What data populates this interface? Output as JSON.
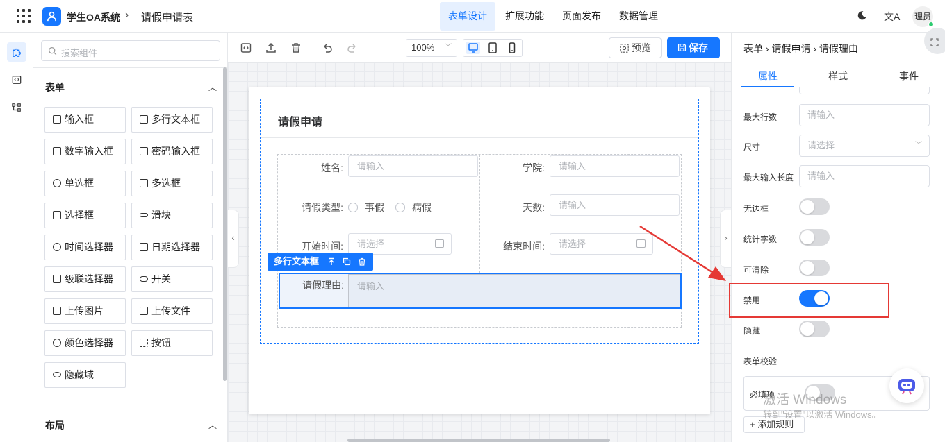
{
  "header": {
    "app_name": "学生OA系统",
    "crumb_sep": "›",
    "page_name": "请假申请表",
    "nav": [
      "表单设计",
      "扩展功能",
      "页面发布",
      "数据管理"
    ],
    "active_nav": "表单设计",
    "translate_glyph": "文A",
    "user": "理员"
  },
  "left_panel": {
    "search_placeholder": "搜索组件",
    "section_form": "表单",
    "components": [
      "输入框",
      "多行文本框",
      "数字输入框",
      "密码输入框",
      "单选框",
      "多选框",
      "选择框",
      "滑块",
      "时间选择器",
      "日期选择器",
      "级联选择器",
      "开关",
      "上传图片",
      "上传文件",
      "颜色选择器",
      "按钮",
      "隐藏域"
    ],
    "section_layout": "布局"
  },
  "toolbar": {
    "zoom": "100%",
    "preview": "预览",
    "save": "保存"
  },
  "form": {
    "title": "请假申请",
    "fields": {
      "name_label": "姓名:",
      "name_placeholder": "请输入",
      "college_label": "学院:",
      "college_placeholder": "请输入",
      "leave_type_label": "请假类型:",
      "leave_options": [
        "事假",
        "病假"
      ],
      "days_label": "天数:",
      "days_placeholder": "请输入",
      "start_label": "开始时间:",
      "start_placeholder": "请选择",
      "end_label": "结束时间:",
      "end_placeholder": "请选择",
      "reason_label": "请假理由:",
      "reason_placeholder": "请输入"
    },
    "selected_chip": "多行文本框"
  },
  "right_panel": {
    "breadcrumb": "表单 › 请假申请 › 请假理由",
    "tabs": [
      "属性",
      "样式",
      "事件"
    ],
    "active_tab": "属性",
    "props": {
      "max_rows_label": "最大行数",
      "max_rows_placeholder": "请输入",
      "size_label": "尺寸",
      "size_placeholder": "请选择",
      "max_length_label": "最大输入长度",
      "max_length_placeholder": "请输入",
      "borderless_label": "无边框",
      "borderless": false,
      "count_label": "统计字数",
      "count": false,
      "clearable_label": "可清除",
      "clearable": false,
      "disabled_label": "禁用",
      "disabled": true,
      "hidden_label": "隐藏",
      "hidden": false
    },
    "validation_title": "表单校验",
    "required_label": "必填项",
    "add_rule": "+ 添加规则"
  },
  "watermark": {
    "line1": "激活 Windows",
    "line2": "转到\"设置\"以激活 Windows。"
  },
  "colors": {
    "accent": "#1677ff",
    "highlight": "#e53935"
  }
}
